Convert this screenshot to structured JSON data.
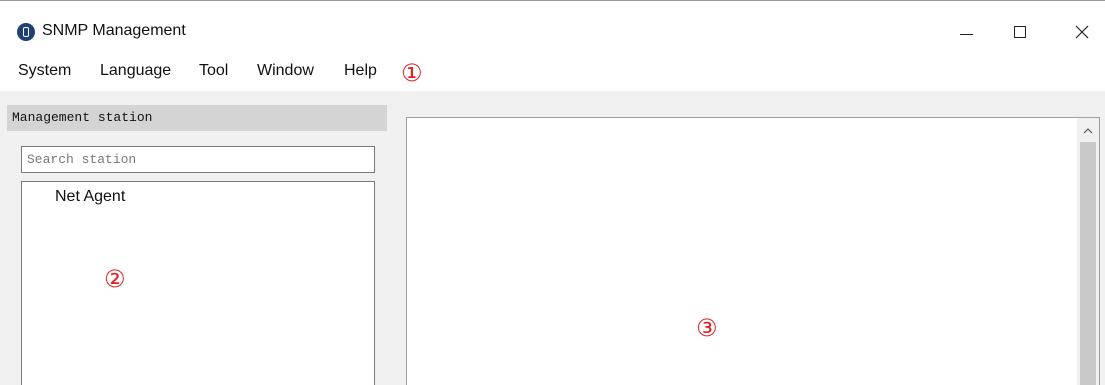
{
  "window": {
    "title": "SNMP Management",
    "controls": {
      "minimize": "—",
      "close": "✕"
    }
  },
  "menu": {
    "items": [
      "System",
      "Language",
      "Tool",
      "Window",
      "Help"
    ]
  },
  "annotations": [
    "①",
    "②",
    "③"
  ],
  "left_panel": {
    "header": "Management station",
    "search_placeholder": "Search station",
    "tree": [
      "Net Agent"
    ]
  },
  "colors": {
    "annotation": "#e02020",
    "app_icon": "#1f3f78",
    "panel_header_bg": "#d4d4d4"
  }
}
